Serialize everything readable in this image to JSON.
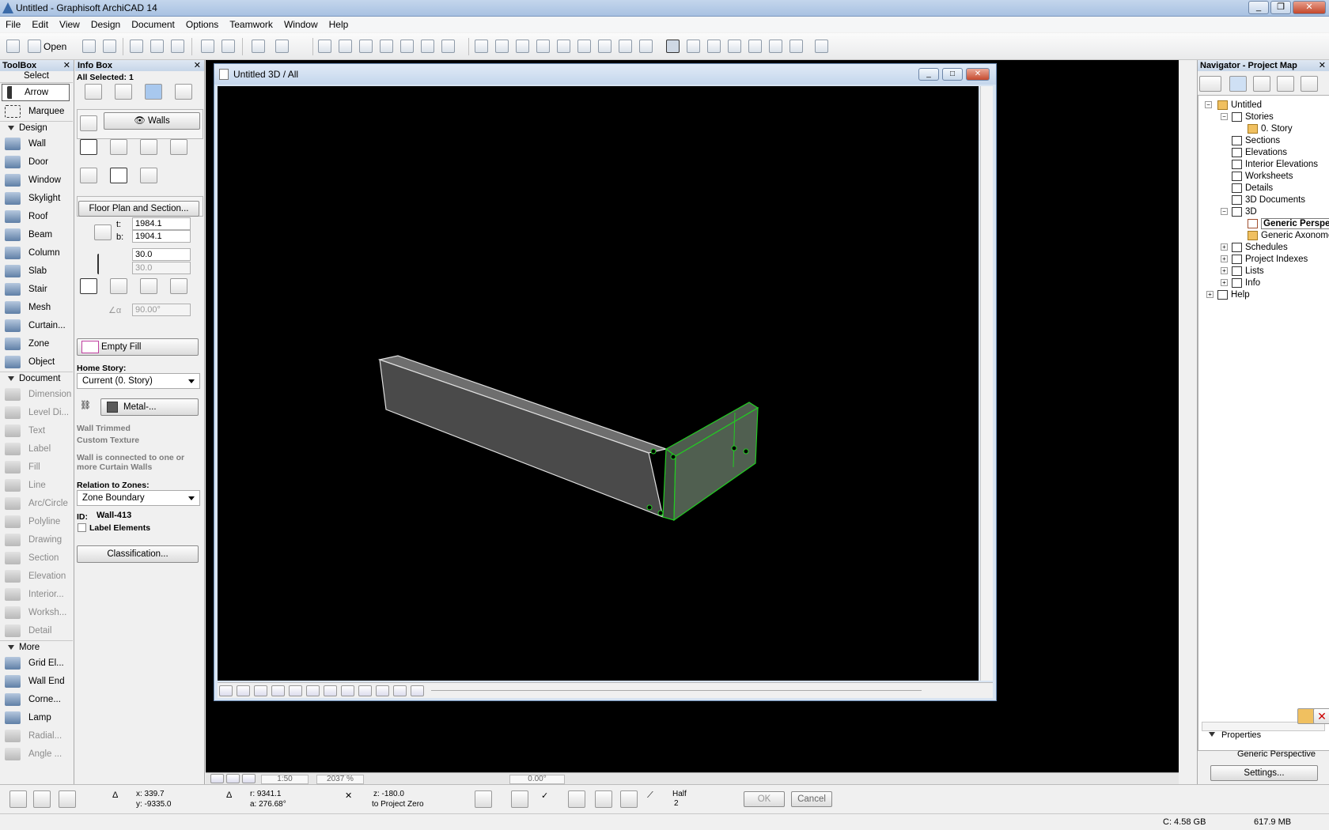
{
  "app": {
    "title": "Untitled - Graphisoft ArchiCAD 14"
  },
  "menu": [
    "File",
    "Edit",
    "View",
    "Design",
    "Document",
    "Options",
    "Teamwork",
    "Window",
    "Help"
  ],
  "toolbar": {
    "open_label": "Open"
  },
  "toolbox": {
    "title": "ToolBox",
    "select_header": "Select",
    "select_items": [
      "Arrow",
      "Marquee"
    ],
    "design_header": "Design",
    "design_items": [
      "Wall",
      "Door",
      "Window",
      "Skylight",
      "Roof",
      "Beam",
      "Column",
      "Slab",
      "Stair",
      "Mesh",
      "Curtain...",
      "Zone",
      "Object"
    ],
    "document_header": "Document",
    "document_items": [
      "Dimension",
      "Level Di...",
      "Text",
      "Label",
      "Fill",
      "Line",
      "Arc/Circle",
      "Polyline",
      "Drawing",
      "Section",
      "Elevation",
      "Interior...",
      "Worksh...",
      "Detail"
    ],
    "more_header": "More",
    "more_items": [
      "Grid El...",
      "Wall End",
      "Corne...",
      "Lamp",
      "Radial...",
      "Angle ..."
    ]
  },
  "infobox": {
    "title": "Info Box",
    "selection": "All Selected: 1",
    "tool_name": "Walls",
    "floor_plan_button": "Floor Plan and Section...",
    "thickness_t_label": "t:",
    "thickness_t": "1984.1",
    "thickness_b_label": "b:",
    "thickness_b": "1904.1",
    "height": "30.0",
    "height2": "30.0",
    "angle": "90.00°",
    "fill": "Empty Fill",
    "home_story_label": "Home Story:",
    "home_story": "Current (0. Story)",
    "material": "Metal-...",
    "wall_trimmed": "Wall Trimmed",
    "custom_texture": "Custom Texture",
    "curtain_note": "Wall is connected to one or more Curtain Walls",
    "zones_label": "Relation to Zones:",
    "zones_value": "Zone Boundary",
    "id_label": "ID:",
    "id_value": "Wall-413",
    "label_elements": "Label Elements",
    "classification_button": "Classification..."
  },
  "window3d": {
    "title": "Untitled 3D / All"
  },
  "bottom_nav": {
    "scale": "1:50",
    "zoom": "2037 %",
    "angle": "0.00°"
  },
  "navigator": {
    "title": "Navigator - Project Map",
    "tree": [
      "Untitled",
      "Stories",
      "0. Story",
      "Sections",
      "Elevations",
      "Interior Elevations",
      "Worksheets",
      "Details",
      "3D Documents",
      "3D",
      "Generic Perspe",
      "Generic Axonome",
      "Schedules",
      "Project Indexes",
      "Lists",
      "Info",
      "Help"
    ],
    "properties_label": "Properties",
    "property_value": "Generic Perspective",
    "settings_button": "Settings..."
  },
  "status": {
    "x": "x: 339.7",
    "y": "y: -9335.0",
    "r": "r: 9341.1",
    "a": "a: 276.68°",
    "z": "z: -180.0",
    "z_ref": "to Project Zero",
    "half": "Half",
    "half_n": "2",
    "ok": "OK",
    "cancel": "Cancel",
    "disk": "C: 4.58 GB",
    "memory": "617.9 MB"
  },
  "colors": {
    "selection_green": "#22cc22",
    "wall_gray": "#5a5a5a"
  }
}
